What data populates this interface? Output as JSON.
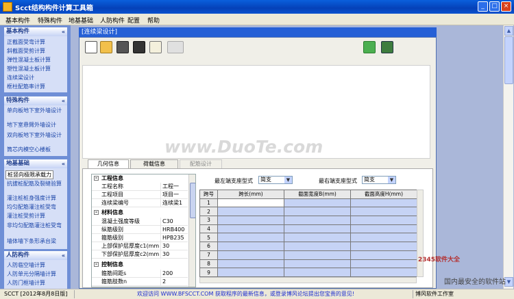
{
  "window": {
    "title": "Scct结构构件计算工具箱",
    "min": "_",
    "max": "□",
    "close": "×"
  },
  "menu": [
    "基本构件",
    "特殊构件",
    "地基基础",
    "人防构件",
    "配置",
    "帮助"
  ],
  "sidebar": {
    "chevron": "«",
    "groups": [
      {
        "title": "基本构件",
        "items": [
          "正截面受弯计算",
          "斜截面受剪计算",
          "弹性混凝土板计算",
          "塑性混凝土板计算",
          "连续梁设计",
          "框柱配筋率计算"
        ]
      },
      {
        "title": "特殊构件",
        "items": [
          "单向板地下室外墙设计",
          "地下室悬臂外墙设计",
          "双向板地下室外墙设计",
          "筒芯内模空心楼板"
        ]
      },
      {
        "title": "地基基础",
        "items": [
          "桩竖向极限承载力",
          "抗拔桩配筋及裂缝验算",
          "灌注桩桩身强度计算",
          "均匀配筋灌注桩受弯",
          "灌注桩受剪计算",
          "非均匀配筋灌注桩受弯",
          "墙体墙下条形承台梁"
        ],
        "selected": 0
      },
      {
        "title": "人防构件",
        "items": [
          "人防临空墙计算",
          "人防单元分隔墙计算",
          "人防门框墙计算"
        ]
      }
    ]
  },
  "doc": {
    "title": "[连续梁设计]",
    "toolbar": [
      "new-icon",
      "open-icon",
      "save-icon",
      "save-all-icon",
      "clipboard-icon",
      "calc-icon",
      "help-icon",
      "exit-icon"
    ],
    "watermark": "www.DuoTe.com",
    "tabs": [
      "几何信息",
      "荷载信息",
      "配筋设计"
    ],
    "active_tab": 0
  },
  "props": {
    "toggle": "-",
    "categories": [
      {
        "name": "工程信息",
        "rows": [
          [
            "工程名称",
            "工程一"
          ],
          [
            "工程项目",
            "项目一"
          ],
          [
            "连续梁编号",
            "连续梁1"
          ]
        ]
      },
      {
        "name": "材料信息",
        "rows": [
          [
            "混凝土强度等级",
            "C30"
          ],
          [
            "纵筋级别",
            "HRB400"
          ],
          [
            "箍筋级别",
            "HPB235"
          ],
          [
            "上部保护层厚度c1(mm)",
            "30"
          ],
          [
            "下部保护层厚度c2(mm)",
            "30"
          ]
        ]
      },
      {
        "name": "控制信息",
        "rows": [
          [
            "箍筋间距s",
            "200"
          ],
          [
            "箍筋肢数n",
            "2"
          ]
        ]
      }
    ]
  },
  "supports": {
    "left_label": "最左端支座型式",
    "left_value": "简支",
    "right_label": "最右端支座型式",
    "right_value": "简支",
    "arrow": "▼"
  },
  "spans": {
    "headers": [
      "跨号",
      "跨长(mm)",
      "截面宽度B(mm)",
      "截面高度H(mm)"
    ],
    "rows": [
      "1",
      "2",
      "3",
      "4",
      "5",
      "6",
      "7",
      "8",
      "9"
    ]
  },
  "branding": {
    "site": "2345软件大全",
    "slogan": "国内最安全的软件站"
  },
  "status": {
    "version": "SCCT [2012年8月8日版]",
    "message": "欢迎访问 WWW.BFSCCT.COM 获取程序的最新信息，或登录博风论坛提出您宝贵的意见!",
    "studio": "博风软件工作室【WWW.BFSCCT.COM】"
  },
  "colors": {
    "titlebar": "#0541b8",
    "sidebar": "#6f8fd6",
    "cell_blue": "#c6d3f5"
  }
}
